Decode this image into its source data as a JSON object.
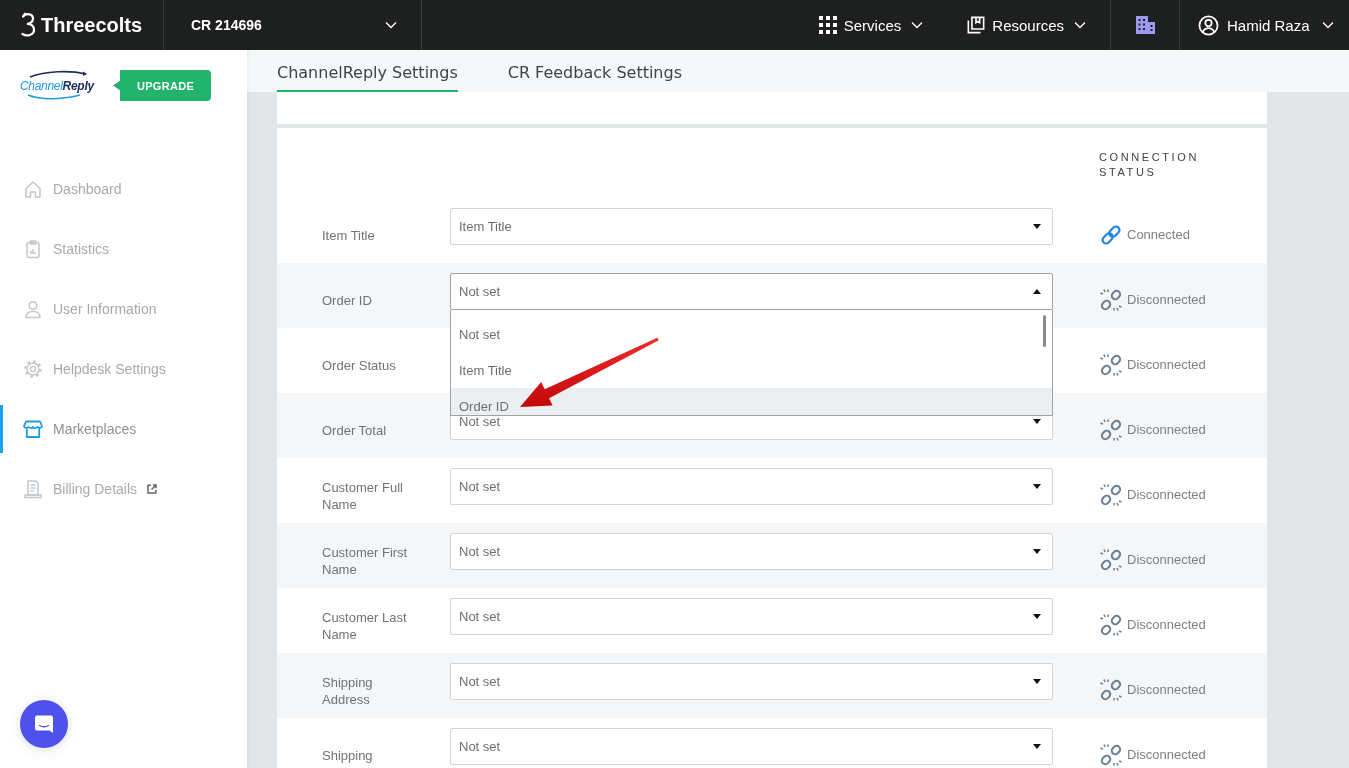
{
  "top_bar": {
    "brand": "Threecolts",
    "account": "CR 214696",
    "menus": [
      {
        "label": "Services"
      },
      {
        "label": "Resources"
      }
    ],
    "user": "Hamid Raza"
  },
  "sidebar": {
    "logo": "Channel**Reply**",
    "upgrade": "UPGRADE",
    "items": [
      {
        "label": "Dashboard",
        "selected": false,
        "external": false
      },
      {
        "label": "Statistics",
        "selected": false,
        "external": false
      },
      {
        "label": "User Information",
        "selected": false,
        "external": false
      },
      {
        "label": "Helpdesk Settings",
        "selected": false,
        "external": false
      },
      {
        "label": "Marketplaces",
        "selected": true,
        "external": false
      },
      {
        "label": "Billing Details",
        "selected": false,
        "external": true
      }
    ]
  },
  "tabs": [
    {
      "label": "ChannelReply Settings",
      "selected": true
    },
    {
      "label": "CR Feedback Settings",
      "selected": false
    }
  ],
  "mapping": {
    "status_heading": "CONNECTION STATUS",
    "rows": [
      {
        "label": "Item Title",
        "value": "Item Title",
        "open": false,
        "status": "Connected",
        "connected": true
      },
      {
        "label": "Order ID",
        "value": "Not set",
        "open": true,
        "options": [
          {
            "label": "Not set",
            "highlighted": false
          },
          {
            "label": "Item Title",
            "highlighted": false
          },
          {
            "label": "Order ID",
            "highlighted": true
          }
        ],
        "status": "Disconnected",
        "connected": false
      },
      {
        "label": "Order Status",
        "status": "Disconnected",
        "connected": false
      },
      {
        "label": "Order Total",
        "value": "Not set",
        "open": false,
        "status": "Disconnected",
        "connected": false
      },
      {
        "label": "Customer Full Name",
        "value": "Not set",
        "open": false,
        "status": "Disconnected",
        "connected": false
      },
      {
        "label": "Customer First Name",
        "value": "Not set",
        "open": false,
        "status": "Disconnected",
        "connected": false
      },
      {
        "label": "Customer Last Name",
        "value": "Not set",
        "open": false,
        "status": "Disconnected",
        "connected": false
      },
      {
        "label": "Shipping Address",
        "value": "Not set",
        "open": false,
        "status": "Disconnected",
        "connected": false
      },
      {
        "label": "Shipping",
        "value": "Not set",
        "open": false,
        "status": "Disconnected",
        "connected": false
      }
    ]
  }
}
